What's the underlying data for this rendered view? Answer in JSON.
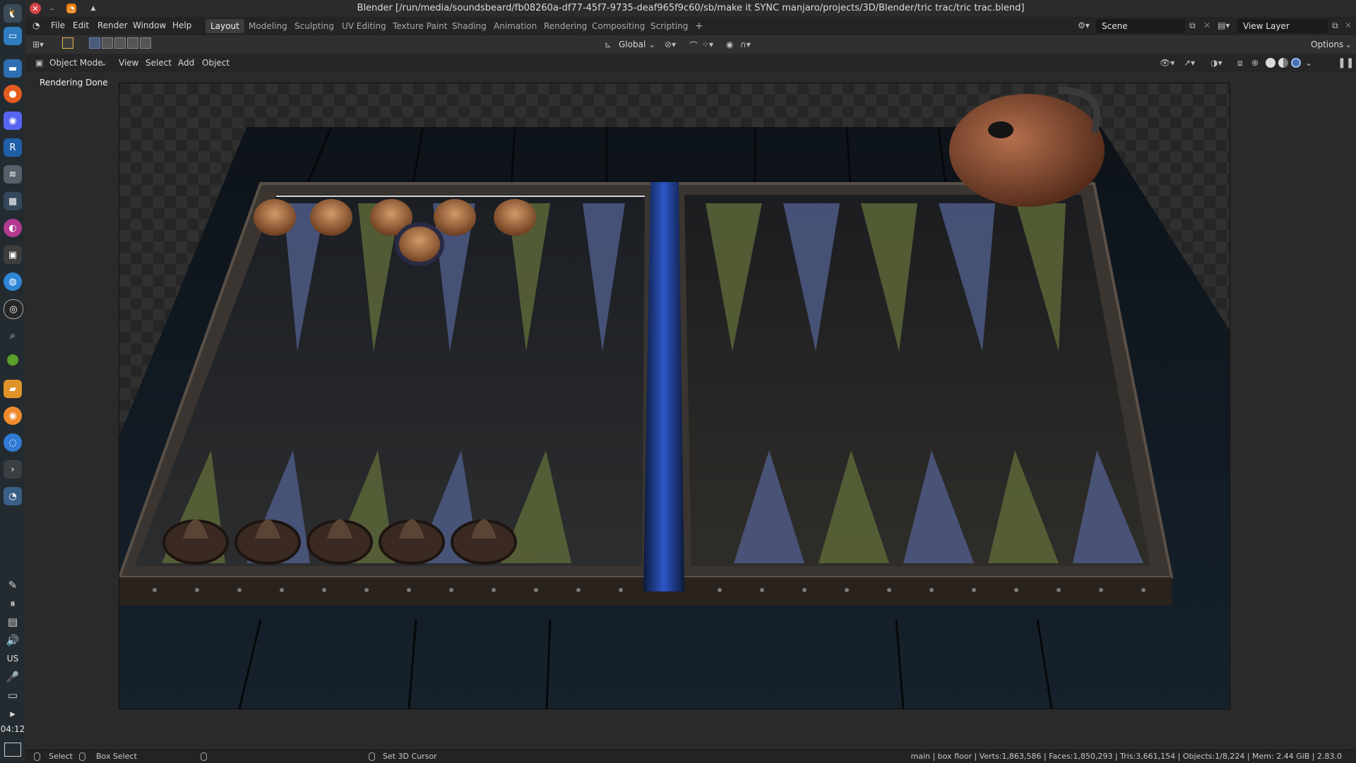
{
  "window": {
    "title": "Blender [/run/media/soundsbeard/fb08260a-df77-45f7-9735-deaf965f9c60/sb/make it SYNC manjaro/projects/3D/Blender/tric trac/tric trac.blend]"
  },
  "dock": {
    "apps": [
      "files-icon",
      "firefox-icon",
      "discord-icon",
      "r-app-icon",
      "layers-icon",
      "calendar-icon",
      "color-app-icon",
      "media-icon",
      "globe-icon",
      "obs-icon",
      "search-icon",
      "green-dot-icon",
      "folder-icon",
      "orange-app-icon",
      "blue-app-icon",
      "terminal-icon",
      "blender-icon"
    ],
    "tray": [
      "bird-icon",
      "pause-icon",
      "clipboard-icon",
      "volume-icon"
    ],
    "keyboard_layout": "US",
    "tray2": [
      "microphone-icon",
      "display-icon",
      "expand-icon"
    ],
    "clock": "04:12"
  },
  "menus": [
    "File",
    "Edit",
    "Render",
    "Window",
    "Help"
  ],
  "workspaces": [
    {
      "label": "Layout",
      "active": true
    },
    {
      "label": "Modeling",
      "active": false
    },
    {
      "label": "Sculpting",
      "active": false
    },
    {
      "label": "UV Editing",
      "active": false
    },
    {
      "label": "Texture Paint",
      "active": false
    },
    {
      "label": "Shading",
      "active": false
    },
    {
      "label": "Animation",
      "active": false
    },
    {
      "label": "Rendering",
      "active": false
    },
    {
      "label": "Compositing",
      "active": false
    },
    {
      "label": "Scripting",
      "active": false
    }
  ],
  "add_workspace": "+",
  "scene": {
    "value": "Scene"
  },
  "view_layer": {
    "value": "View Layer"
  },
  "tool_header": {
    "transform_orientation": "Global",
    "options_label": "Options"
  },
  "viewport_header": {
    "mode": "Object Mode",
    "menus": [
      "View",
      "Select",
      "Add",
      "Object"
    ]
  },
  "viewport": {
    "status": "Rendering Done"
  },
  "status_bar": {
    "left": [
      "Select",
      "Box Select"
    ],
    "middle": "Set 3D Cursor",
    "stats": "main | box floor | Verts:1,863,586 | Faces:1,850,293 | Tris:3,661,154 | Objects:1/8,224 | Mem: 2.44 GiB | 2.83.0"
  },
  "colors": {
    "accent": "#4772b3",
    "active_tab": "#3d3d3d",
    "window_bg": "#1d1d1d"
  }
}
